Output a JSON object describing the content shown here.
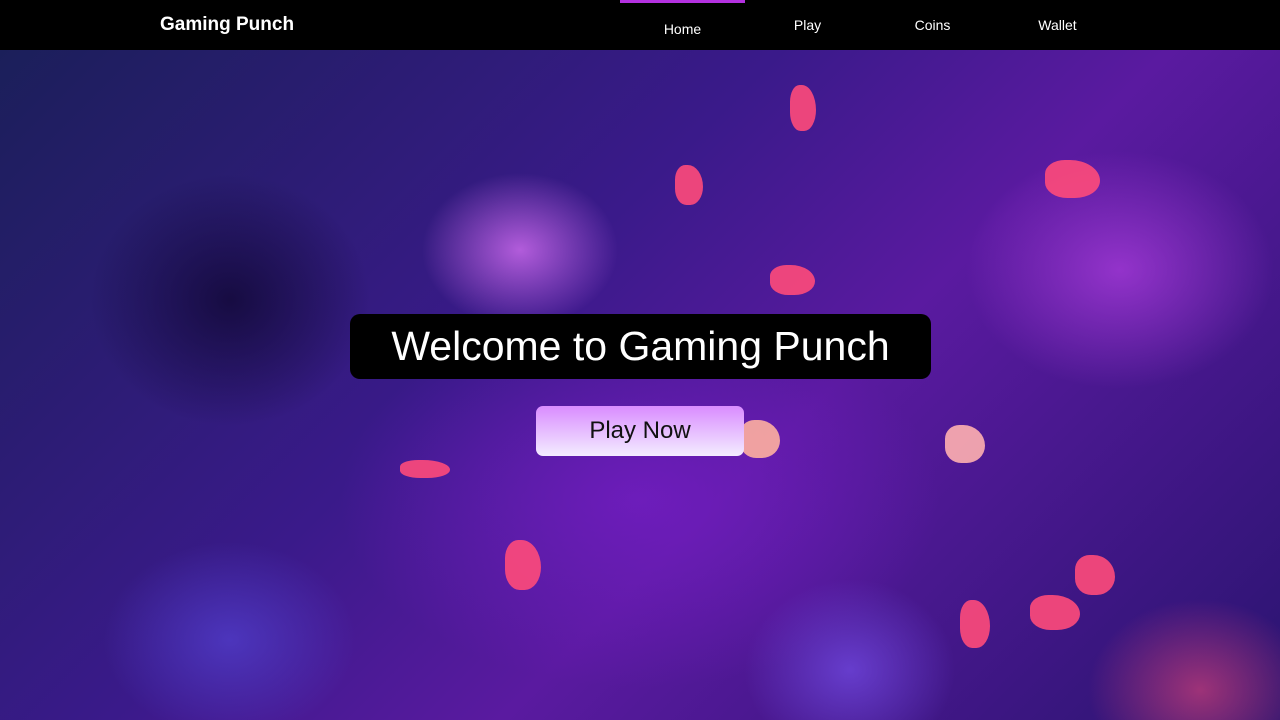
{
  "nav": {
    "brand": "Gaming Punch",
    "items": [
      {
        "label": "Home",
        "active": true
      },
      {
        "label": "Play"
      },
      {
        "label": "Coins"
      },
      {
        "label": "Wallet"
      }
    ]
  },
  "hero": {
    "title": "Welcome to Gaming Punch",
    "cta": "Play Now"
  },
  "colors": {
    "accent": "#b431e0",
    "nav_bg": "#000000"
  }
}
